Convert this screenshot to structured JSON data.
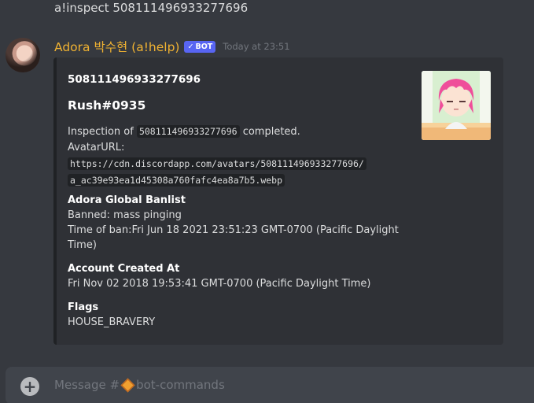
{
  "previous_message": "a!inspect 508111496933277696",
  "message": {
    "username": "Adora 박수현 (a!help)",
    "bot_tag": "BOT",
    "timestamp": "Today at 23:51"
  },
  "embed": {
    "author": "508111496933277696",
    "title": "Rush#0935",
    "desc_prefix": "Inspection of ",
    "desc_code": "508111496933277696",
    "desc_suffix": " completed.",
    "avatar_label": "AvatarURL:",
    "avatar_url_line1": "https://cdn.discordapp.com/avatars/508111496933277696/",
    "avatar_url_line2": "a_ac39e93ea1d45308a760fafc4ea8a7b5.webp",
    "fields": [
      {
        "name": "Adora Global Banlist",
        "value": "Banned: mass pinging",
        "value2": "Time of ban:Fri Jun 18 2021 23:51:23 GMT-0700 (Pacific Daylight Time)"
      },
      {
        "name": "Account Created At",
        "value": "Fri Nov 02 2018 19:53:41 GMT-0700 (Pacific Daylight Time)"
      },
      {
        "name": "Flags",
        "value": "HOUSE_BRAVERY"
      }
    ],
    "left_border_color": "#202225"
  },
  "composer": {
    "placeholder_prefix": "Message #",
    "channel_name": "bot-commands"
  },
  "colors": {
    "username": "#f0b232",
    "bot_tag": "#5865f2",
    "background": "#36393f",
    "embed_bg": "#2f3136"
  }
}
